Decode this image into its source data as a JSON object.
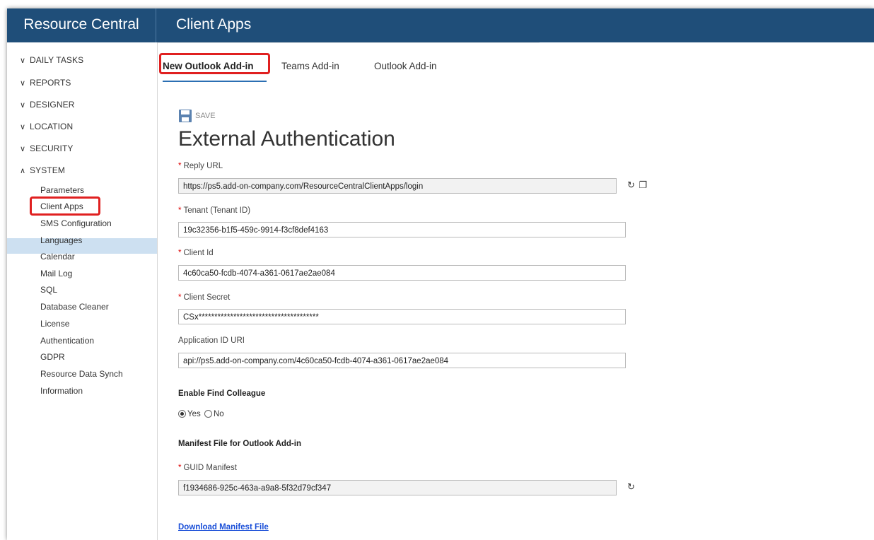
{
  "app": {
    "title": "Resource Central"
  },
  "header": {
    "page_title": "Client Apps"
  },
  "sidebar": {
    "sections": [
      {
        "label": "DAILY TASKS",
        "expanded": false
      },
      {
        "label": "REPORTS",
        "expanded": false
      },
      {
        "label": "DESIGNER",
        "expanded": false
      },
      {
        "label": "LOCATION",
        "expanded": false
      },
      {
        "label": "SECURITY",
        "expanded": false
      },
      {
        "label": "SYSTEM",
        "expanded": true
      }
    ],
    "system_items": [
      "Parameters",
      "Client Apps",
      "SMS Configuration",
      "Languages",
      "Calendar",
      "Mail Log",
      "SQL",
      "Database Cleaner",
      "License",
      "Authentication",
      "GDPR",
      "Resource Data Synch",
      "Information"
    ],
    "selected_item": "Client Apps"
  },
  "tabs": [
    {
      "label": "New Outlook Add-in",
      "active": true
    },
    {
      "label": "Teams Add-in",
      "active": false
    },
    {
      "label": "Outlook Add-in",
      "active": false
    }
  ],
  "toolbar": {
    "save_label": "SAVE"
  },
  "form": {
    "title": "External Authentication",
    "reply_url": {
      "label": "Reply URL",
      "required": true,
      "value": "https://ps5.add-on-company.com/ResourceCentralClientApps/login"
    },
    "tenant": {
      "label": "Tenant (Tenant ID)",
      "required": true,
      "value": "19c32356-b1f5-459c-9914-f3cf8def4163"
    },
    "client_id": {
      "label": "Client Id",
      "required": true,
      "value": "4c60ca50-fcdb-4074-a361-0617ae2ae084"
    },
    "client_secret": {
      "label": "Client Secret",
      "required": true,
      "value": "CSx**************************************"
    },
    "app_id_uri": {
      "label": "Application ID URI",
      "required": false,
      "value": "api://ps5.add-on-company.com/4c60ca50-fcdb-4074-a361-0617ae2ae084"
    },
    "find_colleague": {
      "label": "Enable Find Colleague",
      "yes": "Yes",
      "no": "No",
      "selected": "Yes"
    },
    "manifest": {
      "heading": "Manifest File for Outlook Add-in",
      "guid_label": "GUID Manifest",
      "guid_required": true,
      "guid_value": "f1934686-925c-463a-a9a8-5f32d79cf347",
      "download_label": "Download Manifest File"
    }
  },
  "colors": {
    "header": "#1f4e79",
    "highlight_box": "#e02020",
    "selected_bg": "#cde0f1",
    "link": "#1a4fd8"
  }
}
